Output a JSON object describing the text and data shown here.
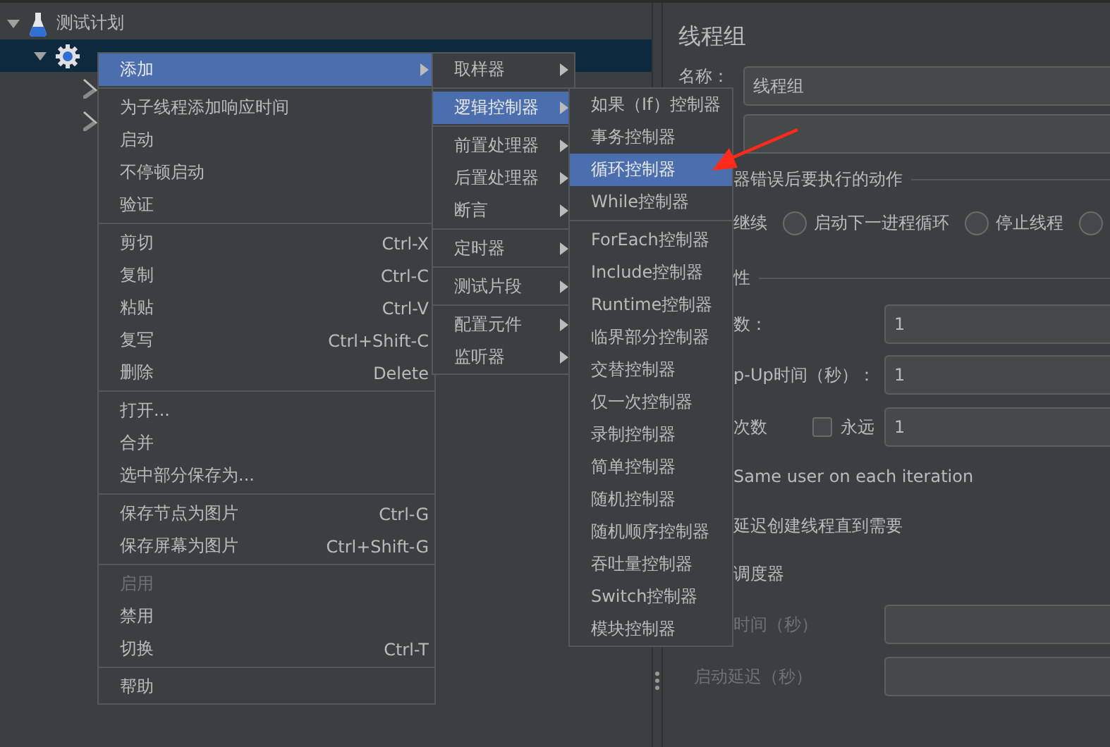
{
  "tree": [
    {
      "label": "测试计划",
      "expanded": true,
      "selected": false
    },
    {
      "expanded": true,
      "selected": true
    },
    {
      "selected": false
    },
    {
      "selected": false
    }
  ],
  "menus": [
    {
      "groups": [
        [
          {
            "label": "添加",
            "submenu": true,
            "selected": true,
            "disabled": false
          }
        ],
        [
          {
            "label": "为子线程添加响应时间",
            "selected": false,
            "disabled": false
          },
          {
            "label": "启动",
            "selected": false,
            "disabled": false
          },
          {
            "label": "不停顿启动",
            "selected": false,
            "disabled": false
          },
          {
            "label": "验证",
            "selected": false,
            "disabled": false
          }
        ],
        [
          {
            "label": "剪切",
            "shortcut": "Ctrl-X",
            "selected": false,
            "disabled": false
          },
          {
            "label": "复制",
            "shortcut": "Ctrl-C",
            "selected": false,
            "disabled": false
          },
          {
            "label": "粘贴",
            "shortcut": "Ctrl-V",
            "selected": false,
            "disabled": false
          },
          {
            "label": "复写",
            "shortcut": "Ctrl+Shift-C",
            "selected": false,
            "disabled": false
          },
          {
            "label": "删除",
            "shortcut": "Delete",
            "selected": false,
            "disabled": false
          }
        ],
        [
          {
            "label": "打开...",
            "selected": false,
            "disabled": false
          },
          {
            "label": "合并",
            "selected": false,
            "disabled": false
          },
          {
            "label": "选中部分保存为...",
            "selected": false,
            "disabled": false
          }
        ],
        [
          {
            "label": "保存节点为图片",
            "shortcut": "Ctrl-G",
            "selected": false,
            "disabled": false
          },
          {
            "label": "保存屏幕为图片",
            "shortcut": "Ctrl+Shift-G",
            "selected": false,
            "disabled": false
          }
        ],
        [
          {
            "label": "启用",
            "selected": false,
            "disabled": true
          },
          {
            "label": "禁用",
            "selected": false,
            "disabled": false
          },
          {
            "label": "切换",
            "shortcut": "Ctrl-T",
            "selected": false,
            "disabled": false
          }
        ],
        [
          {
            "label": "帮助",
            "selected": false,
            "disabled": false
          }
        ]
      ]
    },
    {
      "groups": [
        [
          {
            "label": "取样器",
            "submenu": true,
            "selected": false,
            "disabled": false
          }
        ],
        [
          {
            "label": "逻辑控制器",
            "submenu": true,
            "selected": true,
            "disabled": false
          }
        ],
        [
          {
            "label": "前置处理器",
            "submenu": true,
            "selected": false,
            "disabled": false
          },
          {
            "label": "后置处理器",
            "submenu": true,
            "selected": false,
            "disabled": false
          },
          {
            "label": "断言",
            "submenu": true,
            "selected": false,
            "disabled": false
          }
        ],
        [
          {
            "label": "定时器",
            "submenu": true,
            "selected": false,
            "disabled": false
          }
        ],
        [
          {
            "label": "测试片段",
            "submenu": true,
            "selected": false,
            "disabled": false
          }
        ],
        [
          {
            "label": "配置元件",
            "submenu": true,
            "selected": false,
            "disabled": false
          },
          {
            "label": "监听器",
            "submenu": true,
            "selected": false,
            "disabled": false
          }
        ]
      ]
    },
    {
      "groups": [
        [
          {
            "label": "如果（If）控制器",
            "selected": false,
            "disabled": false
          },
          {
            "label": "事务控制器",
            "selected": false,
            "disabled": false
          },
          {
            "label": "循环控制器",
            "selected": true,
            "disabled": false
          },
          {
            "label": "While控制器",
            "selected": false,
            "disabled": false
          }
        ],
        [
          {
            "label": "ForEach控制器",
            "selected": false,
            "disabled": false
          },
          {
            "label": "Include控制器",
            "selected": false,
            "disabled": false
          },
          {
            "label": "Runtime控制器",
            "selected": false,
            "disabled": false
          },
          {
            "label": "临界部分控制器",
            "selected": false,
            "disabled": false
          },
          {
            "label": "交替控制器",
            "selected": false,
            "disabled": false
          },
          {
            "label": "仅一次控制器",
            "selected": false,
            "disabled": false
          },
          {
            "label": "录制控制器",
            "selected": false,
            "disabled": false
          },
          {
            "label": "简单控制器",
            "selected": false,
            "disabled": false
          },
          {
            "label": "随机控制器",
            "selected": false,
            "disabled": false
          },
          {
            "label": "随机顺序控制器",
            "selected": false,
            "disabled": false
          },
          {
            "label": "吞吐量控制器",
            "selected": false,
            "disabled": false
          },
          {
            "label": "Switch控制器",
            "selected": false,
            "disabled": false
          },
          {
            "label": "模块控制器",
            "selected": false,
            "disabled": false
          }
        ]
      ]
    }
  ],
  "panel": {
    "title": "线程组",
    "rows": [
      {
        "kind": "field",
        "label": "名称：",
        "value": "线程组"
      },
      {
        "kind": "field"
      },
      {
        "kind": "section",
        "label": "器错误后要执行的动作"
      },
      {
        "kind": "radios",
        "options": [
          {
            "kind": "label",
            "label": "继续"
          },
          {
            "kind": "radio",
            "label": "启动下一进程循环",
            "selected": false
          },
          {
            "kind": "radio",
            "label": "停止线程",
            "selected": false
          },
          {
            "kind": "radio",
            "selected": false
          }
        ]
      },
      {
        "kind": "section",
        "label": "性"
      },
      {
        "kind": "field",
        "label": "数：",
        "value": "1"
      },
      {
        "kind": "field",
        "label": "p-Up时间（秒）：",
        "value": "1"
      },
      {
        "kind": "loop",
        "label": "次数",
        "check_label": "永远",
        "checked": false,
        "value": "1"
      },
      {
        "kind": "text",
        "label": "Same user on each iteration"
      },
      {
        "kind": "text",
        "label": "延迟创建线程直到需要"
      },
      {
        "kind": "text",
        "label": "调度器"
      },
      {
        "kind": "field",
        "label": "时间（秒）",
        "disabled": true
      },
      {
        "kind": "field",
        "label": "启动延迟（秒）",
        "disabled": true
      }
    ]
  }
}
